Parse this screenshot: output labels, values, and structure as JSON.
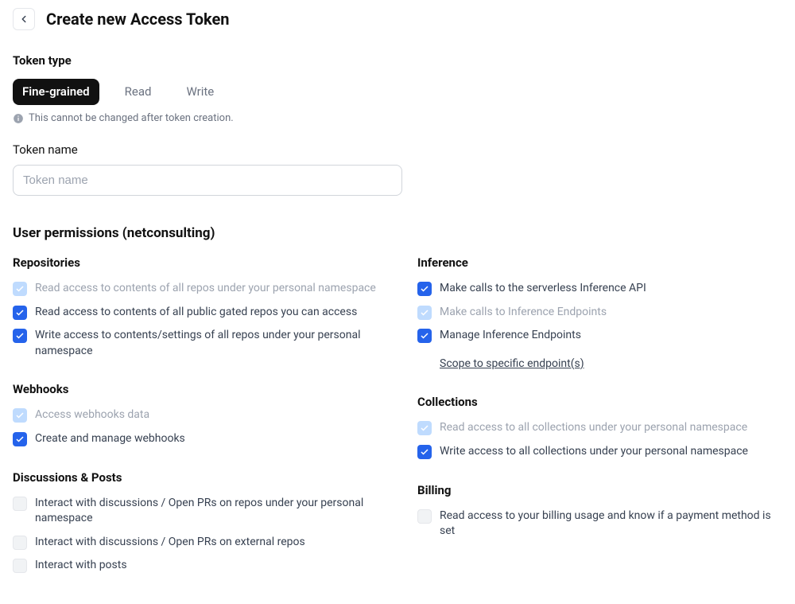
{
  "header": {
    "title": "Create new Access Token"
  },
  "tokenType": {
    "label": "Token type",
    "tabs": {
      "fineGrained": "Fine-grained",
      "read": "Read",
      "write": "Write"
    },
    "hint": "This cannot be changed after token creation."
  },
  "tokenName": {
    "label": "Token name",
    "placeholder": "Token name"
  },
  "userPermissions": {
    "title": "User permissions (netconsulting)",
    "groups": {
      "repositories": {
        "title": "Repositories",
        "items": {
          "readPersonal": "Read access to contents of all repos under your personal namespace",
          "readPublicGated": "Read access to contents of all public gated repos you can access",
          "writePersonal": "Write access to contents/settings of all repos under your personal namespace"
        }
      },
      "inference": {
        "title": "Inference",
        "items": {
          "serverless": "Make calls to the serverless Inference API",
          "endpoints": "Make calls to Inference Endpoints",
          "manage": "Manage Inference Endpoints"
        },
        "scopeLink": "Scope to specific endpoint(s)"
      },
      "webhooks": {
        "title": "Webhooks",
        "items": {
          "access": "Access webhooks data",
          "manage": "Create and manage webhooks"
        }
      },
      "collections": {
        "title": "Collections",
        "items": {
          "read": "Read access to all collections under your personal namespace",
          "write": "Write access to all collections under your personal namespace"
        }
      },
      "discussions": {
        "title": "Discussions & Posts",
        "items": {
          "personal": "Interact with discussions / Open PRs on repos under your personal namespace",
          "external": "Interact with discussions / Open PRs on external repos",
          "posts": "Interact with posts"
        }
      },
      "billing": {
        "title": "Billing",
        "items": {
          "read": "Read access to your billing usage and know if a payment method is set"
        }
      }
    }
  }
}
